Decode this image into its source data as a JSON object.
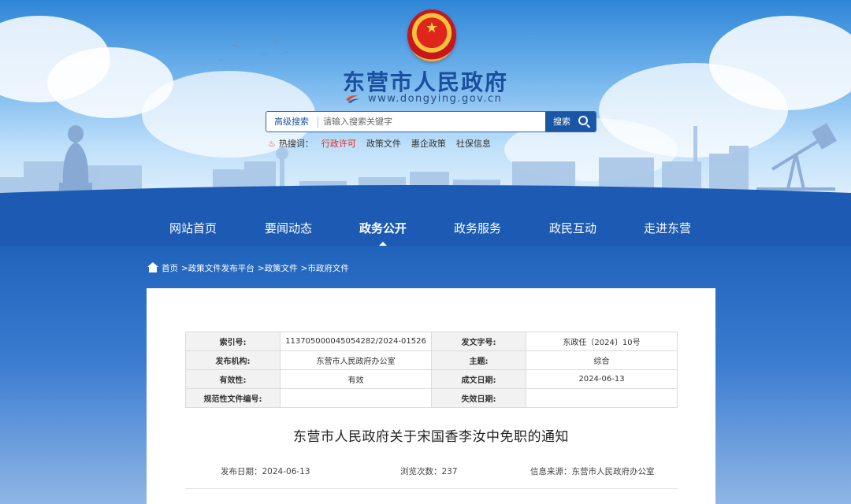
{
  "header": {
    "site_title": "东营市人民政府",
    "site_domain": "www.dongying.gov.cn"
  },
  "search": {
    "advanced_label": "高级搜索",
    "placeholder": "请输入搜索关键字",
    "button_label": "搜索",
    "hot_label": "热搜词：",
    "hot_words": [
      "行政许可",
      "政策文件",
      "惠企政策",
      "社保信息"
    ]
  },
  "nav": {
    "items": [
      "网站首页",
      "要闻动态",
      "政务公开",
      "政务服务",
      "政民互动",
      "走进东营"
    ],
    "active": "政务公开"
  },
  "breadcrumb": [
    "首页",
    ">政策文件发布平台",
    ">政策文件",
    ">市政府文件"
  ],
  "meta": {
    "index_no_label": "索引号:",
    "index_no": "113705000045054282/2024-01526",
    "doc_no_label": "发文字号:",
    "doc_no": "东政任〔2024〕10号",
    "org_label": "发布机构:",
    "org": "东营市人民政府办公室",
    "topic_label": "主题:",
    "topic": "综合",
    "validity_label": "有效性:",
    "validity": "有效",
    "date_label": "成文日期:",
    "date": "2024-06-13",
    "norm_no_label": "规范性文件编号:",
    "norm_no": "",
    "expire_label": "失效日期:",
    "expire": ""
  },
  "doc": {
    "title": "东营市人民政府关于宋国香李汝中免职的通知",
    "publish_label": "发布日期：",
    "publish_date": "2024-06-13",
    "views_label": "浏览次数：",
    "views": "237",
    "source_label": "信息来源：",
    "source": "东营市人民政府办公室"
  },
  "colors": {
    "brand_blue": "#1c5ab3",
    "hot_red": "#e3271b"
  }
}
